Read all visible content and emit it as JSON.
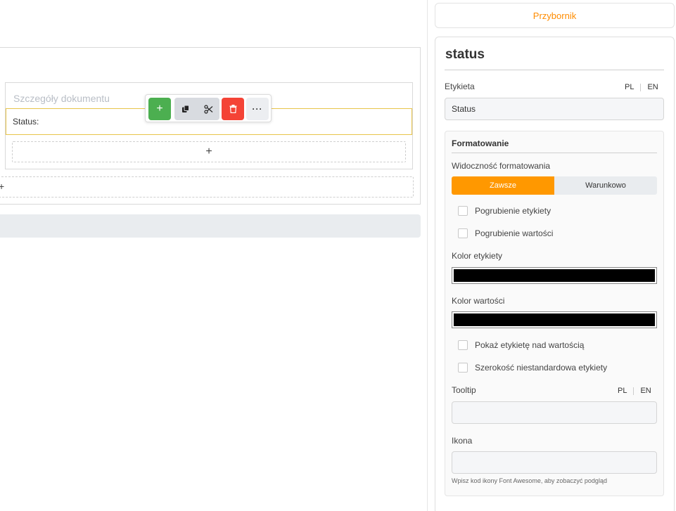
{
  "canvas": {
    "section_title": "Szczegóły dokumentu",
    "field_label": "Status:",
    "add_symbol": "+",
    "toolbar": {
      "add_symbol": "+",
      "more_symbol": "···",
      "colors": {
        "add": "#4caf50",
        "group": "#d8dbe0",
        "delete": "#f44336",
        "more": "#eceef1"
      },
      "icons": [
        "plus-icon",
        "copy-icon",
        "scissors-icon",
        "trash-icon",
        "ellipsis-icon"
      ]
    },
    "selection_border_color": "#e8c44a"
  },
  "sidebar": {
    "tab_label": "Przybornik",
    "accent_color": "#ff8c00",
    "title": "status",
    "label_field": {
      "label": "Etykieta",
      "lang_pl": "PL",
      "lang_en": "EN",
      "value": "Status"
    },
    "formatting": {
      "title": "Formatowanie",
      "visibility_label": "Widoczność formatowania",
      "option_always": "Zawsze",
      "option_conditional": "Warunkowo",
      "selected_option": "Zawsze",
      "bold_label": "Pogrubienie etykiety",
      "bold_value": "Pogrubienie wartości",
      "label_color_label": "Kolor etykiety",
      "label_color": "#000000",
      "value_color_label": "Kolor wartości",
      "value_color": "#000000",
      "show_label_above": "Pokaż etykietę nad wartością",
      "custom_label_width": "Szerokość niestandardowa etykiety",
      "tooltip_label": "Tooltip",
      "tooltip_lang_pl": "PL",
      "tooltip_lang_en": "EN",
      "tooltip_value": "",
      "icon_label": "Ikona",
      "icon_value": "",
      "icon_hint": "Wpisz kod ikony Font Awesome, aby zobaczyć podgląd"
    }
  }
}
